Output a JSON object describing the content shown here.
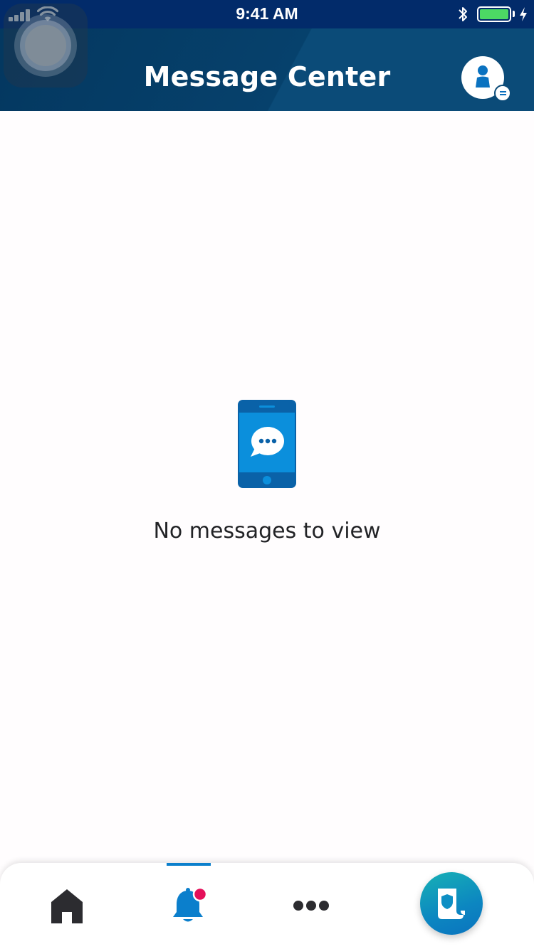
{
  "status_bar": {
    "time": "9:41 AM"
  },
  "header": {
    "title": "Message Center"
  },
  "empty_state": {
    "message": "No messages to view"
  },
  "bottom_nav": {
    "items": [
      {
        "icon": "home-icon"
      },
      {
        "icon": "bell-icon",
        "selected": true,
        "has_notification_dot": true
      },
      {
        "icon": "more-icon"
      }
    ],
    "fab_icon": "shield-document-icon"
  },
  "colors": {
    "header_bg": "#0b4b78",
    "status_bar_bg": "#022b6a",
    "accent_blue": "#0b7fcc",
    "notification_dot": "#e4105a",
    "battery_green": "#4cd964",
    "fab_gradient_start": "#17b1b5",
    "fab_gradient_end": "#0a73be",
    "empty_text": "#222326"
  }
}
